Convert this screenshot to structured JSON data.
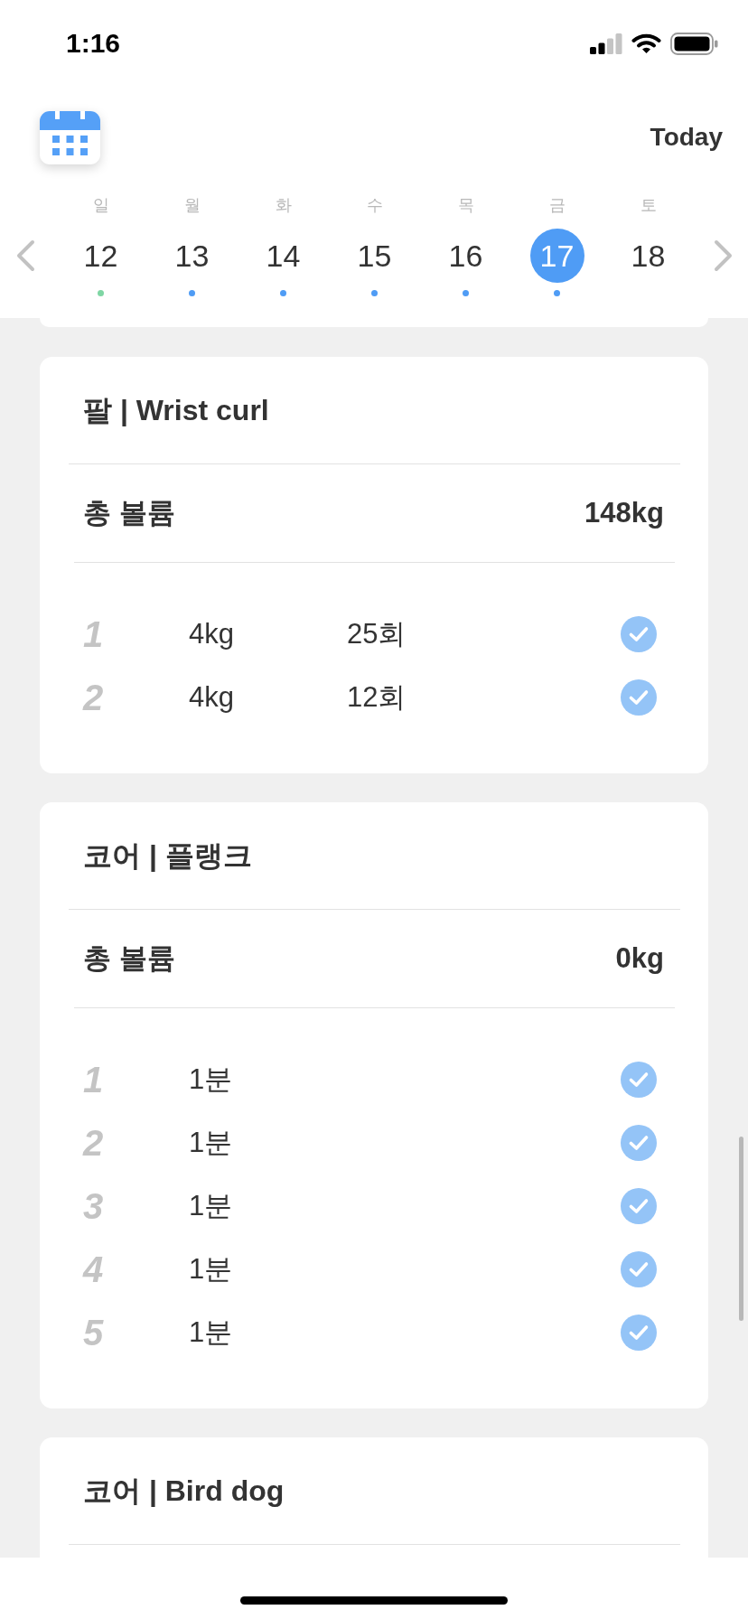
{
  "status_bar": {
    "time": "1:16"
  },
  "header": {
    "today_button": "Today"
  },
  "week": {
    "days": [
      {
        "weekday": "일",
        "date": "12",
        "selected": false,
        "color": "#7fd6a4"
      },
      {
        "weekday": "월",
        "date": "13",
        "selected": false,
        "color": "#4f9cf5"
      },
      {
        "weekday": "화",
        "date": "14",
        "selected": false,
        "color": "#4f9cf5"
      },
      {
        "weekday": "수",
        "date": "15",
        "selected": false,
        "color": "#4f9cf5"
      },
      {
        "weekday": "목",
        "date": "16",
        "selected": false,
        "color": "#4f9cf5"
      },
      {
        "weekday": "금",
        "date": "17",
        "selected": true,
        "color": "#4f9cf5"
      },
      {
        "weekday": "토",
        "date": "18",
        "selected": false
      }
    ]
  },
  "exercises": [
    {
      "title": "팔 | Wrist curl",
      "total_label": "총 볼륨",
      "total_value": "148kg",
      "sets": [
        {
          "number": "1",
          "values": [
            "4kg",
            "25회"
          ],
          "checked": true
        },
        {
          "number": "2",
          "values": [
            "4kg",
            "12회"
          ],
          "checked": true
        }
      ]
    },
    {
      "title": "코어 | 플랭크",
      "total_label": "총 볼륨",
      "total_value": "0kg",
      "sets": [
        {
          "number": "1",
          "values": [
            "1분"
          ],
          "checked": true
        },
        {
          "number": "2",
          "values": [
            "1분"
          ],
          "checked": true
        },
        {
          "number": "3",
          "values": [
            "1분"
          ],
          "checked": true
        },
        {
          "number": "4",
          "values": [
            "1분"
          ],
          "checked": true
        },
        {
          "number": "5",
          "values": [
            "1분"
          ],
          "checked": true
        }
      ]
    },
    {
      "title": "코어 | Bird dog"
    }
  ]
}
